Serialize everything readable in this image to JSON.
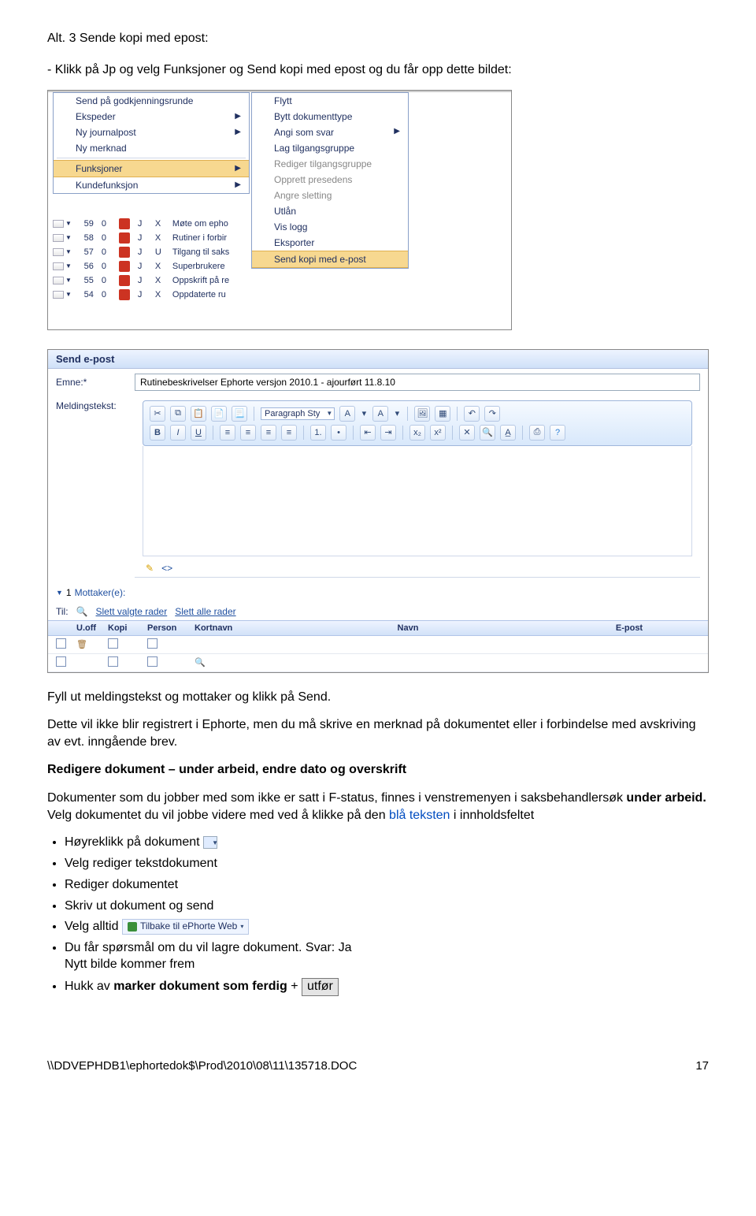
{
  "heading": "Alt. 3 Sende kopi med epost:",
  "intro": "- Klikk på Jp og velg Funksjoner og Send kopi med epost og du får opp dette bildet:",
  "menu1": {
    "items": [
      "Send på godkjenningsrunde",
      "Ekspeder",
      "Ny journalpost",
      "Ny merknad",
      "Funksjoner",
      "Kundefunksjon"
    ],
    "selected_index": 4
  },
  "menu2": {
    "items": [
      {
        "label": "Flytt",
        "enabled": true
      },
      {
        "label": "Bytt dokumenttype",
        "enabled": true
      },
      {
        "label": "Angi som svar",
        "enabled": true,
        "arrow": true
      },
      {
        "label": "Lag tilgangsgruppe",
        "enabled": true
      },
      {
        "label": "Rediger tilgangsgruppe",
        "enabled": false
      },
      {
        "label": "Opprett presedens",
        "enabled": false
      },
      {
        "label": "Angre sletting",
        "enabled": false
      },
      {
        "label": "Utlån",
        "enabled": true
      },
      {
        "label": "Vis logg",
        "enabled": true
      },
      {
        "label": "Eksporter",
        "enabled": true
      },
      {
        "label": "Send kopi med e-post",
        "enabled": true
      }
    ],
    "selected_index": 10
  },
  "gridrows": [
    {
      "num": "59",
      "zero": "0",
      "j": "J",
      "s": "X",
      "title": "Møte om epho"
    },
    {
      "num": "58",
      "zero": "0",
      "j": "J",
      "s": "X",
      "title": "Rutiner i forbir"
    },
    {
      "num": "57",
      "zero": "0",
      "j": "J",
      "s": "U",
      "title": "Tilgang til saks"
    },
    {
      "num": "56",
      "zero": "0",
      "j": "J",
      "s": "X",
      "title": "Superbrukere"
    },
    {
      "num": "55",
      "zero": "0",
      "j": "J",
      "s": "X",
      "title": "Oppskrift på re"
    },
    {
      "num": "54",
      "zero": "0",
      "j": "J",
      "s": "X",
      "title": "Oppdaterte ru"
    }
  ],
  "send_epost": {
    "title": "Send e-post",
    "emne_label": "Emne:*",
    "emne_value": "Rutinebeskrivelser Ephorte versjon 2010.1 - ajourført 11.8.10",
    "meldingstekst_label": "Meldingstekst:",
    "para_style": "Paragraph Sty",
    "mottakere_label": "Mottaker(e):",
    "mottakere_count": "1",
    "til_label": "Til:",
    "slett_valgte": "Slett valgte rader",
    "slett_alle": "Slett alle rader",
    "headers": {
      "uoff": "U.off",
      "kopi": "Kopi",
      "person": "Person",
      "kortnavn": "Kortnavn",
      "navn": "Navn",
      "epost": "E-post"
    }
  },
  "after_form_1": "Fyll ut meldingstekst og mottaker og klikk på Send.",
  "after_form_2": "Dette vil ikke blir registrert i Ephorte, men du må skrive en merknad på dokumentet eller i forbindelse med avskriving av evt. inngående brev.",
  "section2_title": "Redigere dokument – under arbeid, endre dato og overskrift",
  "section2_body_1a": "Dokumenter som du jobber med som ikke er satt i F-status, finnes i venstremenyen i saksbehandlersøk ",
  "section2_body_1b": "under arbeid.",
  "section2_body_1c": " Velg dokumentet du vil jobbe videre med ved å klikke på den ",
  "section2_body_1d": "blå teksten",
  "section2_body_1e": " i innholdsfeltet",
  "bullets": {
    "b1": "Høyreklikk på dokument",
    "b2": "Velg rediger tekstdokument",
    "b3": "Rediger dokumentet",
    "b4": "Skriv ut dokument og send",
    "b5a": "Velg alltid ",
    "tilbake_label": "Tilbake til ePhorte Web",
    "b6": "Du får spørsmål om du vil lagre dokument.  Svar: Ja",
    "b6b": "Nytt bilde kommer  frem",
    "b7a": "Hukk av ",
    "b7b": "marker dokument som ferdig",
    "b7c": " + ",
    "b7d": "utfør"
  },
  "footer_path": "\\\\DDVEPHDB1\\ephortedok$\\Prod\\2010\\08\\11\\135718.DOC",
  "footer_page": "17"
}
